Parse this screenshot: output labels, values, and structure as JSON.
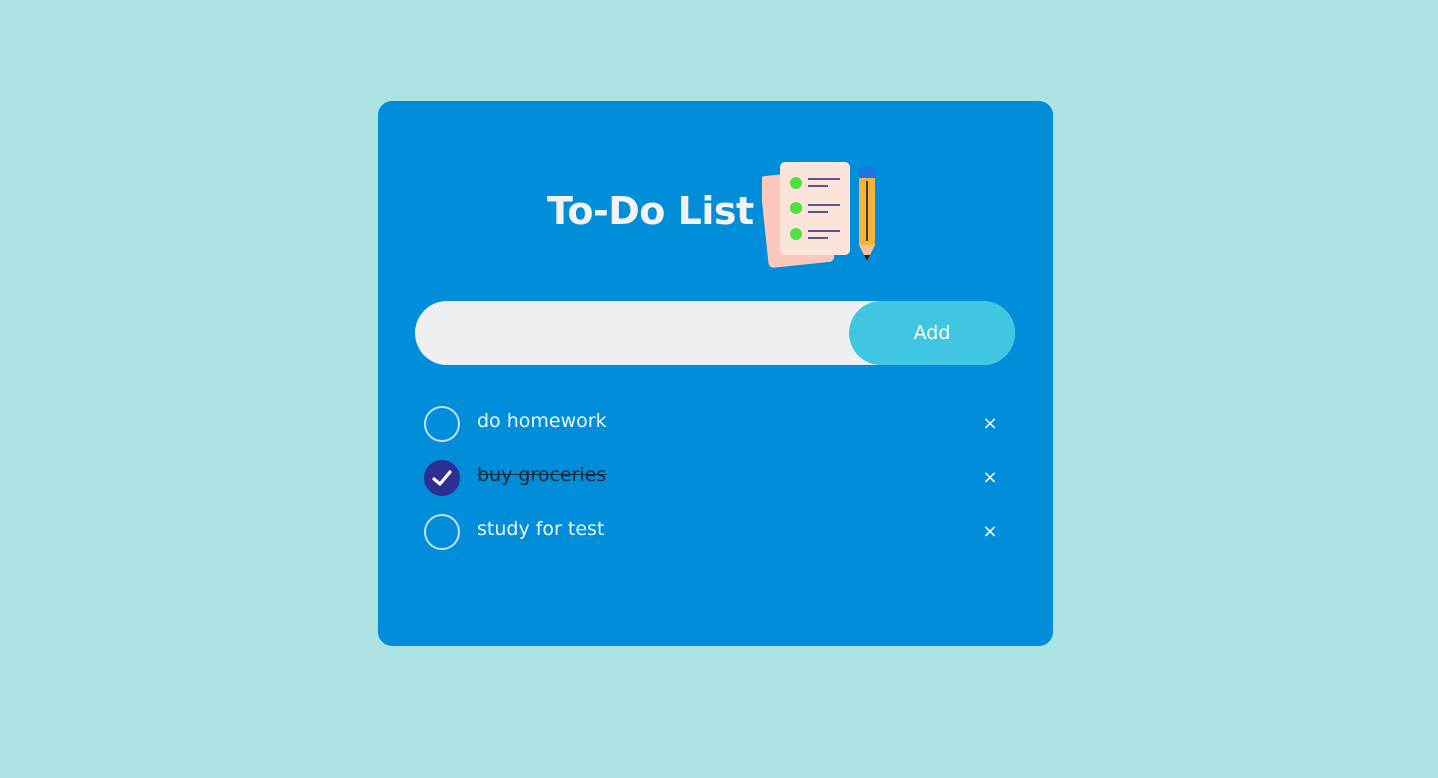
{
  "app": {
    "title": "To-Do List",
    "title_icon": "checklist-notepad-pencil-icon"
  },
  "colors": {
    "page_background": "#ade2e3",
    "card_background": "#008dd9",
    "input_background": "#edeff1",
    "add_button": "#40c6e0",
    "checked_circle": "#2e2f90",
    "checklist_bullet": "#4be13f"
  },
  "input": {
    "value": "",
    "placeholder": ""
  },
  "add_button": {
    "label": "Add"
  },
  "tasks": [
    {
      "text": "do homework",
      "checked": false,
      "delete_label": "×"
    },
    {
      "text": "buy groceries",
      "checked": true,
      "delete_label": "×"
    },
    {
      "text": "study for test",
      "checked": false,
      "delete_label": "×"
    }
  ]
}
